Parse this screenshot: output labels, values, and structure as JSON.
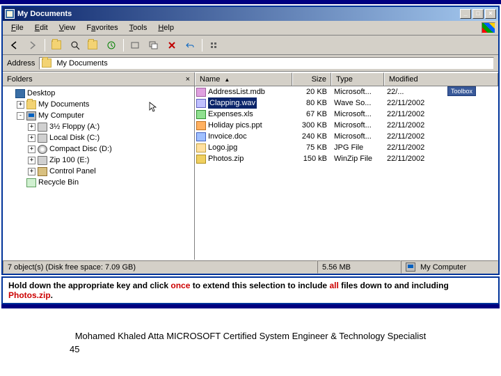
{
  "window": {
    "title": "My Documents",
    "buttons": {
      "min": "_",
      "max": "□",
      "close": "×"
    }
  },
  "menu": {
    "items": [
      {
        "label": "File",
        "u": "F"
      },
      {
        "label": "Edit",
        "u": "E"
      },
      {
        "label": "View",
        "u": "V"
      },
      {
        "label": "Favorites",
        "u": "a"
      },
      {
        "label": "Tools",
        "u": "T"
      },
      {
        "label": "Help",
        "u": "H"
      }
    ]
  },
  "addressbar": {
    "label": "Address",
    "value": "My Documents"
  },
  "folders_pane": {
    "title": "Folders",
    "tree": [
      {
        "id": "desktop",
        "label": "Desktop",
        "icon": "i-desktop",
        "indent": 0,
        "exp": ""
      },
      {
        "id": "mydocs",
        "label": "My Documents",
        "icon": "i-folder",
        "indent": 1,
        "exp": "+"
      },
      {
        "id": "mycomp",
        "label": "My Computer",
        "icon": "i-computer",
        "indent": 1,
        "exp": "-"
      },
      {
        "id": "floppy",
        "label": "3½ Floppy (A:)",
        "icon": "i-drive",
        "indent": 2,
        "exp": "+"
      },
      {
        "id": "localc",
        "label": "Local Disk (C:)",
        "icon": "i-drive",
        "indent": 2,
        "exp": "+"
      },
      {
        "id": "cd",
        "label": "Compact Disc (D:)",
        "icon": "i-cd",
        "indent": 2,
        "exp": "+"
      },
      {
        "id": "zip",
        "label": "Zip 100 (E:)",
        "icon": "i-drive",
        "indent": 2,
        "exp": "+"
      },
      {
        "id": "cpanel",
        "label": "Control Panel",
        "icon": "i-cpanel",
        "indent": 2,
        "exp": "+"
      },
      {
        "id": "recycle",
        "label": "Recycle Bin",
        "icon": "i-recycle",
        "indent": 1,
        "exp": ""
      }
    ]
  },
  "list": {
    "columns": {
      "name": "Name",
      "size": "Size",
      "type": "Type",
      "modified": "Modified"
    },
    "toolbox_label": "Toolbox",
    "files": [
      {
        "name": "AddressList.mdb",
        "size": "20 KB",
        "type": "Microsoft...",
        "modified": "22/...",
        "icon": "fi-db",
        "selected": false
      },
      {
        "name": "Clapping.wav",
        "size": "80 KB",
        "type": "Wave So...",
        "modified": "22/11/2002",
        "icon": "fi-wav",
        "selected": true
      },
      {
        "name": "Expenses.xls",
        "size": "67 KB",
        "type": "Microsoft...",
        "modified": "22/11/2002",
        "icon": "fi-xls",
        "selected": false
      },
      {
        "name": "Holiday pics.ppt",
        "size": "300 KB",
        "type": "Microsoft...",
        "modified": "22/11/2002",
        "icon": "fi-ppt",
        "selected": false
      },
      {
        "name": "Invoice.doc",
        "size": "240 KB",
        "type": "Microsoft...",
        "modified": "22/11/2002",
        "icon": "fi-doc",
        "selected": false
      },
      {
        "name": "Logo.jpg",
        "size": "75 KB",
        "type": "JPG File",
        "modified": "22/11/2002",
        "icon": "fi-jpg",
        "selected": false
      },
      {
        "name": "Photos.zip",
        "size": "150 kB",
        "type": "WinZip File",
        "modified": "22/11/2002",
        "icon": "fi-zip",
        "selected": false
      }
    ]
  },
  "statusbar": {
    "objects": "7 object(s) (Disk free space: 7.09 GB)",
    "size": "5.56 MB",
    "location": "My Computer"
  },
  "instruction": {
    "pre": "Hold down the appropriate key and click ",
    "once": "once",
    "mid": " to extend this selection to include ",
    "all": "all",
    "post1": " files down to and including ",
    "target": "Photos.zip",
    "post2": "."
  },
  "credit": {
    "line": "Mohamed Khaled Atta MICROSOFT Certified System Engineer & Technology Specialist",
    "page": "45"
  }
}
